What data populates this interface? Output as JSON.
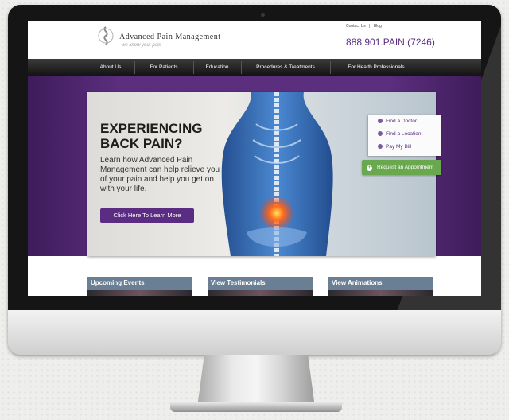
{
  "site": {
    "logo_name": "Advanced Pain Management",
    "logo_tagline": "we know your pain",
    "top_links": [
      "Contact Us",
      "|",
      "Blog"
    ],
    "phone": "888.901.PAIN (7246)"
  },
  "nav": {
    "items": [
      "About Us",
      "For Patients",
      "Education",
      "Procedures & Treatments",
      "For Health Professionals"
    ]
  },
  "hero": {
    "title_line1": "EXPERIENCING",
    "title_line2": "BACK PAIN?",
    "body": "Learn how Advanced Pain Management can help relieve you of your pain and help you get on with your life.",
    "cta": "Click Here To Learn More",
    "slide_count": 5,
    "active_slide": 1
  },
  "quick_links": [
    "Find a Doctor",
    "Find a Location",
    "Pay My Bill"
  ],
  "appointment": "Request an Appointment",
  "tiles": [
    "Upcoming Events",
    "View Testimonials",
    "View Animations"
  ],
  "colors": {
    "brand_purple": "#5a2d82",
    "accent_green": "#6aa84f",
    "nav_dark": "#1a1a1a",
    "tile_slate": "#6a7f93"
  }
}
